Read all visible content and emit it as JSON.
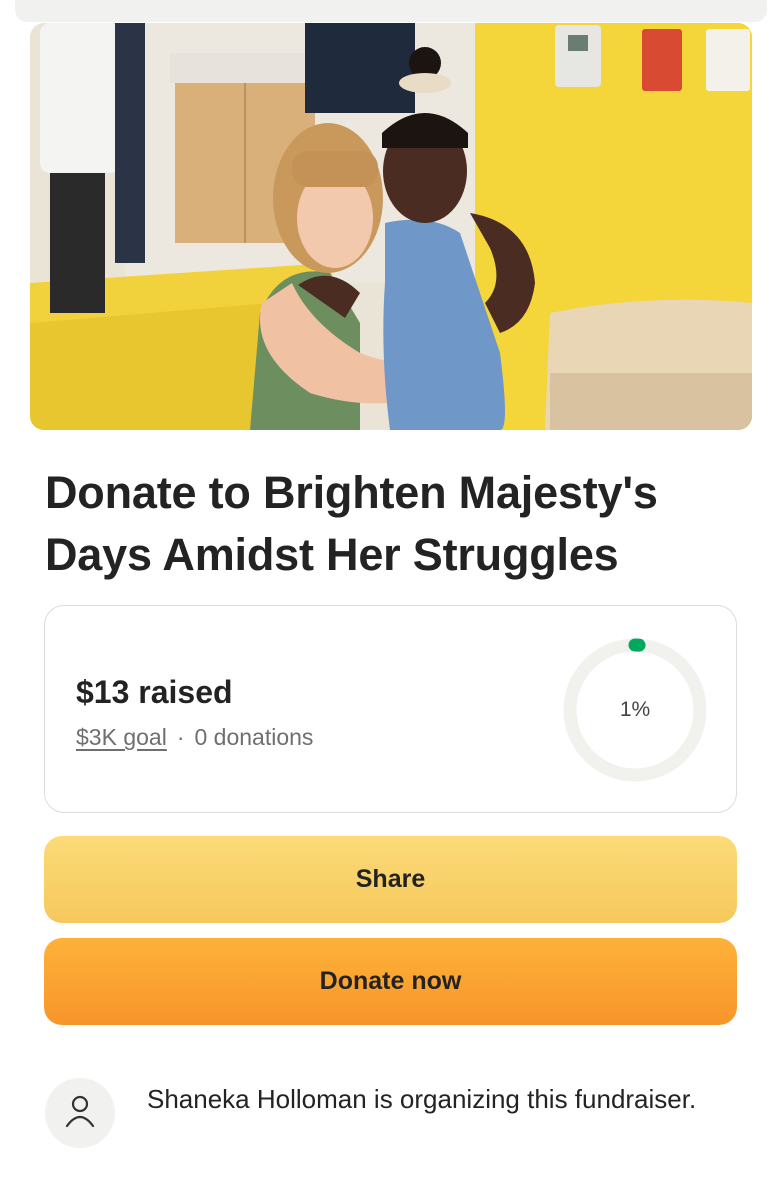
{
  "campaign": {
    "title": "Donate to Brighten Majesty's Days Amidst Her Struggles",
    "hero_image": "photo-woman-hugging-girl-in-hospital-room"
  },
  "progress": {
    "raised": "$13 raised",
    "goal": "$3K goal",
    "separator": "·",
    "donations": "0 donations",
    "percent_label": "1%",
    "percent_value": 0.01,
    "ring_color": "#02a95c",
    "ring_track_color": "#f1f1ee"
  },
  "buttons": {
    "share": "Share",
    "donate": "Donate now"
  },
  "organizer": {
    "text": "Shaneka Holloman is organizing this fundraiser.",
    "icon": "person-icon"
  }
}
